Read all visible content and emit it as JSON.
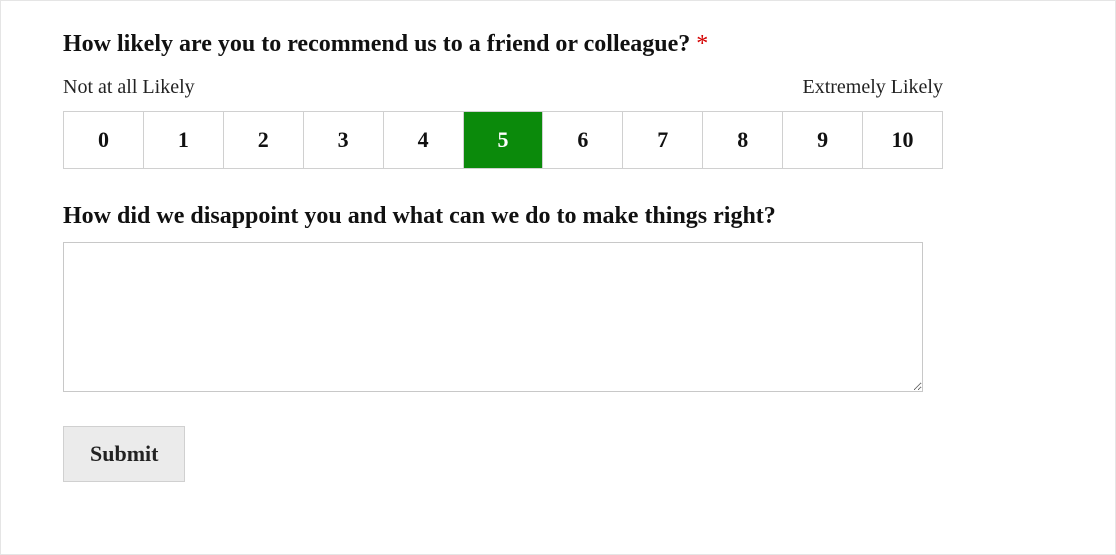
{
  "nps": {
    "question": "How likely are you to recommend us to a friend or colleague?",
    "required_marker": "*",
    "low_label": "Not at all Likely",
    "high_label": "Extremely Likely",
    "options": [
      "0",
      "1",
      "2",
      "3",
      "4",
      "5",
      "6",
      "7",
      "8",
      "9",
      "10"
    ],
    "selected_index": 5
  },
  "followup": {
    "question": "How did we disappoint you and what can we do to make things right?",
    "value": ""
  },
  "submit": {
    "label": "Submit"
  }
}
